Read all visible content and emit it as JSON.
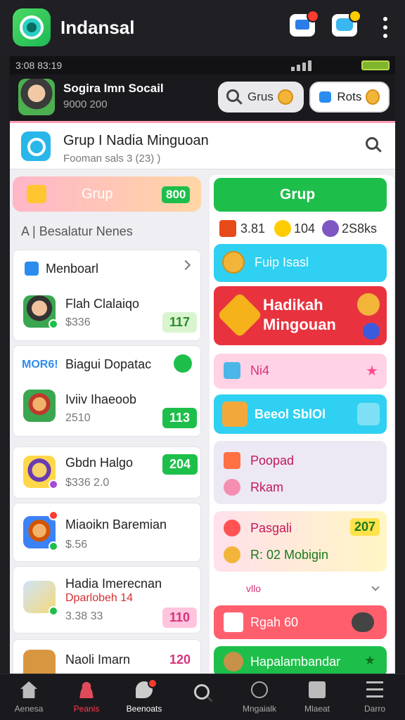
{
  "app": {
    "title": "Indansal"
  },
  "statusbar": {
    "time": "3:08 83:19"
  },
  "profile": {
    "name": "Sogira Imn Socail",
    "sub": "9000 200"
  },
  "header_pills": {
    "grus_label": "Grus",
    "rots_label": "Rots"
  },
  "group_header": {
    "title": "Grup I Nadia Minguoan",
    "subtitle": "Fooman sals 3 (23) )"
  },
  "left": {
    "tab": {
      "label": "Grup",
      "count": "800"
    },
    "section_label": "A | Besalatur Nenes",
    "cards": [
      {
        "title": "Menboarl",
        "sub": ""
      },
      {
        "title": "Flah Clalaiqo",
        "sub": "$336",
        "badge": "117"
      },
      {
        "title": "Biagui Dopatac",
        "tag": "MOR6!",
        "sub": ""
      },
      {
        "title": "Iviiv Ihaeoob",
        "sub": "2510",
        "badge": "113"
      },
      {
        "title": "Gbdn Halgo",
        "sub": "$336  2.0",
        "badge": "204"
      },
      {
        "title": "Miaoikn Baremian",
        "sub": "$.56"
      },
      {
        "title": "Hadia Imerecnan",
        "sub2": "Dparlobeh 14",
        "sub": "3.38  33",
        "badge": "110"
      },
      {
        "title": "Naoli Imarn",
        "badge": "120"
      }
    ]
  },
  "right": {
    "grup_button": "Grup",
    "stats": [
      "3.81",
      "104",
      "2S8ks"
    ],
    "btn_blue": "Fuip Isasl",
    "promo_line1": "Hadikah",
    "promo_line2": "Mingouan",
    "pink_row": "Ni4",
    "cyan_button": "Beeol SblOl",
    "lav_line1": "Poopad",
    "lav_line2": "Rkam",
    "yellow_line1": "Pasgali",
    "yellow_count": "207",
    "yellow_line2": "R: 02  Mobigin",
    "divider_text": "vllo",
    "red_pill": "Rgah  60",
    "green_pill": "Hapalambandar"
  },
  "bottomnav": [
    {
      "label": "Aenesa",
      "icon": "home-icon"
    },
    {
      "label": "Peanis",
      "icon": "user-icon"
    },
    {
      "label": "Beenoats",
      "icon": "chat-icon"
    },
    {
      "label": "",
      "icon": "search-icon"
    },
    {
      "label": "Mngaialk",
      "icon": "compass-icon"
    },
    {
      "label": "Mlaeat",
      "icon": "folder-icon"
    },
    {
      "label": "Darro",
      "icon": "menu-icon"
    }
  ],
  "colors": {
    "accent_green": "#1dbf4a",
    "accent_red": "#e8333f",
    "accent_cyan": "#2fd0f2",
    "pink_border": "#ff9db6"
  }
}
